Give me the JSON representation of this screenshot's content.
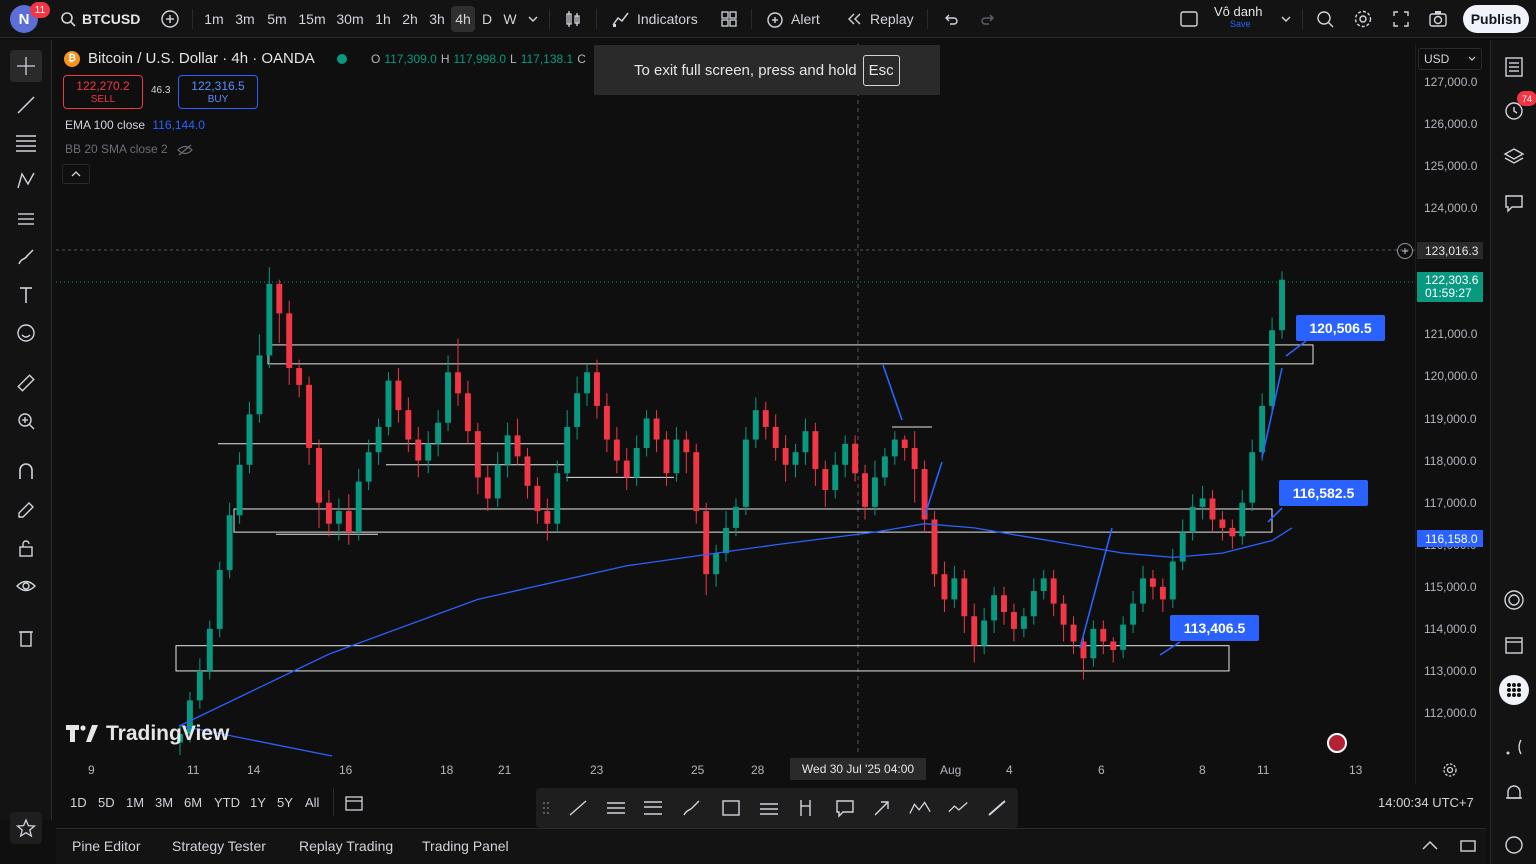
{
  "user": {
    "initial": "N",
    "badge": "11"
  },
  "symbol": "BTCUSD",
  "timeframes": [
    "1m",
    "3m",
    "5m",
    "15m",
    "30m",
    "1h",
    "2h",
    "3h",
    "4h",
    "D",
    "W"
  ],
  "active_timeframe": "4h",
  "toolbar": {
    "indicators": "Indicators",
    "alert": "Alert",
    "replay": "Replay"
  },
  "layout": {
    "name": "Vô danh",
    "save": "Save"
  },
  "publish": "Publish",
  "legend": {
    "title": "Bitcoin / U.S. Dollar · 4h · OANDA",
    "ohlc": {
      "o_label": "O",
      "o": "117,309.0",
      "h_label": "H",
      "h": "117,998.0",
      "l_label": "L",
      "l": "117,138.1",
      "c_label": "C"
    },
    "sell_price": "122,270.2",
    "sell_label": "SELL",
    "buy_price": "122,316.5",
    "buy_label": "BUY",
    "spread": "46.3",
    "ema_label": "EMA 100 close",
    "ema_value": "116,144.0",
    "bb_label": "BB 20 SMA close 2"
  },
  "toast": {
    "text": "To exit full screen, press and hold",
    "key": "Esc"
  },
  "currency": "USD",
  "price_axis": [
    "127,000.0",
    "126,000.0",
    "125,000.0",
    "124,000.0",
    "123,000.0",
    "122,000.0",
    "121,000.0",
    "120,000.0",
    "119,000.0",
    "118,000.0",
    "117,000.0",
    "116,000.0",
    "115,000.0",
    "114,000.0",
    "113,000.0",
    "112,000.0"
  ],
  "price_tags": {
    "crosshair": "123,016.3",
    "last_price": "122,303.6",
    "countdown": "01:59:27",
    "ema": "116,158.0"
  },
  "callouts": [
    "120,506.5",
    "116,582.5",
    "113,406.5"
  ],
  "time_axis": [
    "9",
    "11",
    "14",
    "16",
    "18",
    "21",
    "23",
    "25",
    "28",
    "Aug",
    "4",
    "6",
    "8",
    "11",
    "13"
  ],
  "crosshair_time": "Wed 30 Jul '25   04:00",
  "watermark": "TradingView",
  "ranges": [
    "1D",
    "5D",
    "1M",
    "3M",
    "6M",
    "YTD",
    "1Y",
    "5Y",
    "All"
  ],
  "clock": "14:00:34 UTC+7",
  "bottom_tabs": [
    "Pine Editor",
    "Strategy Tester",
    "Replay Trading",
    "Trading Panel"
  ],
  "notifications_badge": "74",
  "colors": {
    "up": "#089981",
    "down": "#f23645",
    "ema": "#2962ff",
    "accent": "#2962ff"
  },
  "chart_data": {
    "type": "candlestick",
    "symbol": "Bitcoin / U.S. Dollar",
    "interval": "4h",
    "ylim": [
      111500,
      127500
    ],
    "candles": [
      [
        111300,
        111500,
        111000,
        111700
      ],
      [
        111500,
        112300,
        111300,
        112500
      ],
      [
        112300,
        113000,
        112100,
        113300
      ],
      [
        113000,
        114000,
        112800,
        114200
      ],
      [
        114000,
        115400,
        113800,
        115600
      ],
      [
        115400,
        116700,
        115200,
        117000
      ],
      [
        116700,
        117900,
        116500,
        118200
      ],
      [
        117900,
        119100,
        117700,
        119400
      ],
      [
        119100,
        120500,
        118900,
        121000
      ],
      [
        120500,
        122200,
        120200,
        122600
      ],
      [
        122200,
        121500,
        120800,
        122300
      ],
      [
        121500,
        120200,
        119800,
        121800
      ],
      [
        120200,
        119800,
        119500,
        120400
      ],
      [
        119800,
        118300,
        117900,
        120000
      ],
      [
        118300,
        117000,
        116400,
        118500
      ],
      [
        117000,
        116500,
        116200,
        117300
      ],
      [
        116500,
        116800,
        116100,
        117100
      ],
      [
        116800,
        116300,
        116000,
        117200
      ],
      [
        116300,
        117500,
        116100,
        117800
      ],
      [
        117500,
        118200,
        117300,
        118500
      ],
      [
        118200,
        118800,
        117900,
        119000
      ],
      [
        118800,
        119900,
        118600,
        120100
      ],
      [
        119900,
        119200,
        118900,
        120200
      ],
      [
        119200,
        118500,
        118200,
        119500
      ],
      [
        118500,
        118000,
        117600,
        118800
      ],
      [
        118000,
        118400,
        117700,
        118700
      ],
      [
        118400,
        118900,
        118100,
        119200
      ],
      [
        118900,
        120100,
        118700,
        120500
      ],
      [
        120100,
        119600,
        119300,
        120900
      ],
      [
        119600,
        118700,
        118400,
        119900
      ],
      [
        118700,
        117600,
        117200,
        118900
      ],
      [
        117600,
        117100,
        116800,
        117900
      ],
      [
        117100,
        117900,
        116900,
        118200
      ],
      [
        117900,
        118600,
        117600,
        118900
      ],
      [
        118600,
        118100,
        117900,
        119000
      ],
      [
        118100,
        117400,
        117100,
        118300
      ],
      [
        117400,
        116800,
        116500,
        117600
      ],
      [
        116800,
        116500,
        116100,
        117100
      ],
      [
        116500,
        117700,
        116300,
        118000
      ],
      [
        117700,
        118800,
        117500,
        119200
      ],
      [
        118800,
        119600,
        118500,
        120000
      ],
      [
        119600,
        120100,
        119300,
        120300
      ],
      [
        120100,
        119300,
        119000,
        120400
      ],
      [
        119300,
        118500,
        118200,
        119600
      ],
      [
        118500,
        118000,
        117700,
        118800
      ],
      [
        118000,
        117600,
        117300,
        118300
      ],
      [
        117600,
        118300,
        117400,
        118600
      ],
      [
        118300,
        119000,
        118100,
        119200
      ],
      [
        119000,
        118500,
        118200,
        119200
      ],
      [
        118500,
        117700,
        117400,
        118700
      ],
      [
        117700,
        118500,
        117500,
        118800
      ],
      [
        118500,
        118200,
        117700,
        118700
      ],
      [
        118200,
        116800,
        116500,
        118400
      ],
      [
        116800,
        115300,
        114800,
        117000
      ],
      [
        115300,
        115800,
        115000,
        116000
      ],
      [
        115800,
        116400,
        115600,
        116800
      ],
      [
        116400,
        116900,
        116200,
        117100
      ],
      [
        116900,
        118500,
        116700,
        118800
      ],
      [
        118500,
        119200,
        118300,
        119500
      ],
      [
        119200,
        118800,
        118500,
        119400
      ],
      [
        118800,
        118300,
        118000,
        119100
      ],
      [
        118300,
        117900,
        117500,
        118600
      ],
      [
        117900,
        118200,
        117600,
        118400
      ],
      [
        118200,
        118700,
        117900,
        119000
      ],
      [
        118700,
        117800,
        117400,
        118900
      ],
      [
        117800,
        117300,
        116900,
        118000
      ],
      [
        117300,
        117900,
        117100,
        118200
      ],
      [
        117900,
        118400,
        117600,
        118600
      ],
      [
        118400,
        117700,
        117500,
        118600
      ],
      [
        117700,
        116900,
        116600,
        117900
      ],
      [
        116900,
        117600,
        116700,
        118000
      ],
      [
        117600,
        118100,
        117400,
        118300
      ],
      [
        118100,
        118500,
        117900,
        118700
      ],
      [
        118500,
        118300,
        118000,
        118600
      ],
      [
        118300,
        117800,
        117000,
        118700
      ],
      [
        117800,
        116600,
        116300,
        118000
      ],
      [
        116600,
        115300,
        115000,
        116800
      ],
      [
        115300,
        114700,
        114400,
        115600
      ],
      [
        114700,
        115200,
        114500,
        115500
      ],
      [
        115200,
        114300,
        113900,
        115400
      ],
      [
        114300,
        113600,
        113200,
        114600
      ],
      [
        113600,
        114200,
        113400,
        114500
      ],
      [
        114200,
        114800,
        113900,
        115000
      ],
      [
        114800,
        114400,
        114100,
        115000
      ],
      [
        114400,
        114000,
        113700,
        114600
      ],
      [
        114000,
        114300,
        113800,
        114500
      ],
      [
        114300,
        114900,
        114100,
        115200
      ],
      [
        114900,
        115200,
        114700,
        115400
      ],
      [
        115200,
        114600,
        114300,
        115400
      ],
      [
        114600,
        114100,
        113700,
        114800
      ],
      [
        114100,
        113700,
        113400,
        114300
      ],
      [
        113700,
        113300,
        112800,
        113900
      ],
      [
        113300,
        114000,
        113100,
        114200
      ],
      [
        114000,
        113700,
        113400,
        114200
      ],
      [
        113700,
        113500,
        113200,
        113800
      ],
      [
        113500,
        114100,
        113300,
        114300
      ],
      [
        114100,
        114600,
        113900,
        114900
      ],
      [
        114600,
        115200,
        114400,
        115500
      ],
      [
        115200,
        115000,
        114700,
        115400
      ],
      [
        115000,
        114700,
        114400,
        115200
      ],
      [
        114700,
        115600,
        114500,
        115900
      ],
      [
        115600,
        116300,
        115400,
        116600
      ],
      [
        116300,
        116900,
        116100,
        117200
      ],
      [
        116900,
        117100,
        116600,
        117400
      ],
      [
        117100,
        116600,
        116300,
        117300
      ],
      [
        116600,
        116400,
        116100,
        116800
      ],
      [
        116400,
        116200,
        115900,
        116600
      ],
      [
        116200,
        117000,
        116000,
        117300
      ],
      [
        117000,
        118200,
        116800,
        118500
      ],
      [
        118200,
        119300,
        118000,
        119600
      ],
      [
        119300,
        121100,
        119100,
        121400
      ],
      [
        121100,
        122300,
        120900,
        122500
      ]
    ],
    "ema100": [
      [
        0,
        111700
      ],
      [
        15,
        113400
      ],
      [
        30,
        114700
      ],
      [
        45,
        115500
      ],
      [
        60,
        116000
      ],
      [
        70,
        116300
      ],
      [
        75,
        116500
      ],
      [
        80,
        116400
      ],
      [
        85,
        116200
      ],
      [
        90,
        116000
      ],
      [
        95,
        115800
      ],
      [
        100,
        115700
      ],
      [
        105,
        115800
      ],
      [
        110,
        116100
      ],
      [
        112,
        116400
      ]
    ],
    "zones": [
      {
        "from": 120300,
        "to": 120750
      },
      {
        "from": 116300,
        "to": 116850
      },
      {
        "from": 113000,
        "to": 113600
      }
    ],
    "annotations": [
      {
        "label": "120,506.5",
        "y": 120506.5
      },
      {
        "label": "116,582.5",
        "y": 116582.5
      },
      {
        "label": "113,406.5",
        "y": 113406.5
      }
    ]
  }
}
